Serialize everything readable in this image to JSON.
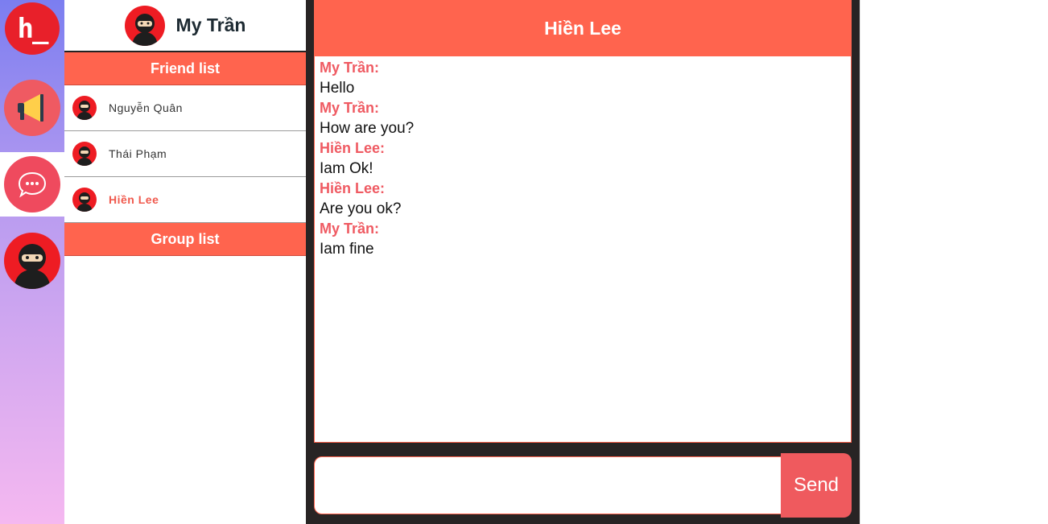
{
  "rail": {
    "logo_text": "h_",
    "items": [
      {
        "icon": "logo-icon"
      },
      {
        "icon": "megaphone-icon"
      },
      {
        "icon": "chat-bubble-icon",
        "active": true
      },
      {
        "icon": "ninja-avatar-icon"
      }
    ]
  },
  "profile": {
    "name": "My Trần"
  },
  "friend_list": {
    "title": "Friend list",
    "friends": [
      {
        "name": "Nguyễn Quân",
        "active": false
      },
      {
        "name": "Thái Phạm",
        "active": false
      },
      {
        "name": "Hiền Lee",
        "active": true
      }
    ]
  },
  "group_list": {
    "title": "Group list"
  },
  "chat": {
    "header_title": "Hiền Lee",
    "messages": [
      {
        "sender": "My Trần:",
        "text": "Hello"
      },
      {
        "sender": "My Trần:",
        "text": "How are you?"
      },
      {
        "sender": "Hiền Lee:",
        "text": "Iam Ok!"
      },
      {
        "sender": "Hiền Lee:",
        "text": "Are you ok?"
      },
      {
        "sender": "My Trần:",
        "text": "Iam fine"
      }
    ],
    "input_value": "",
    "send_label": "Send"
  },
  "colors": {
    "accent": "#ff644e",
    "sender": "#ef5a62",
    "panel_dark": "#282424",
    "avatar_red": "#ee1c23"
  }
}
